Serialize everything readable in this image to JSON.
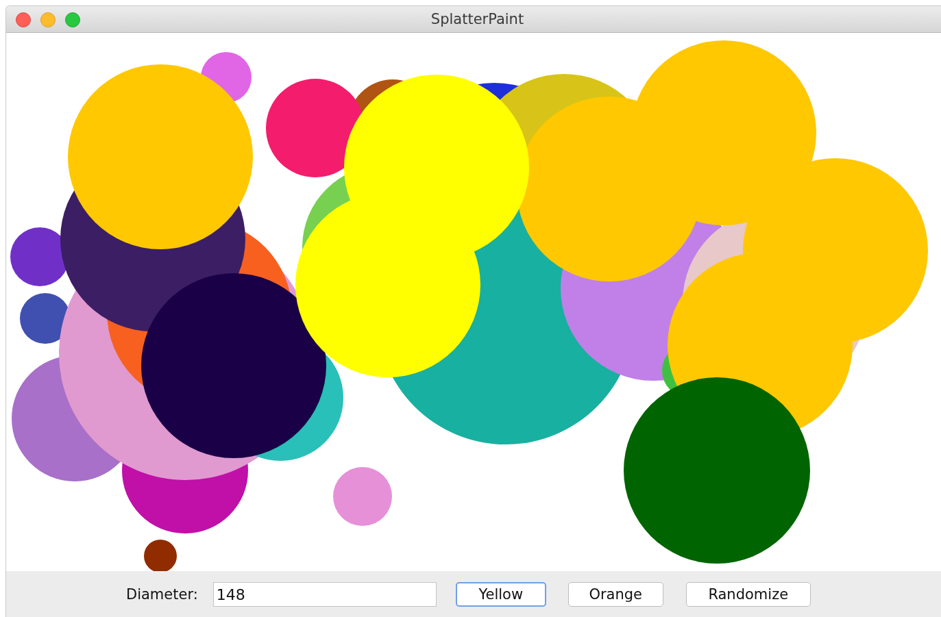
{
  "window": {
    "title": "SplatterPaint"
  },
  "controls": {
    "diameter_label": "Diameter:",
    "diameter_value": "148",
    "buttons": [
      {
        "label": "Yellow",
        "focused": true
      },
      {
        "label": "Orange",
        "focused": false
      },
      {
        "label": "Randomize",
        "focused": false
      }
    ]
  }
}
